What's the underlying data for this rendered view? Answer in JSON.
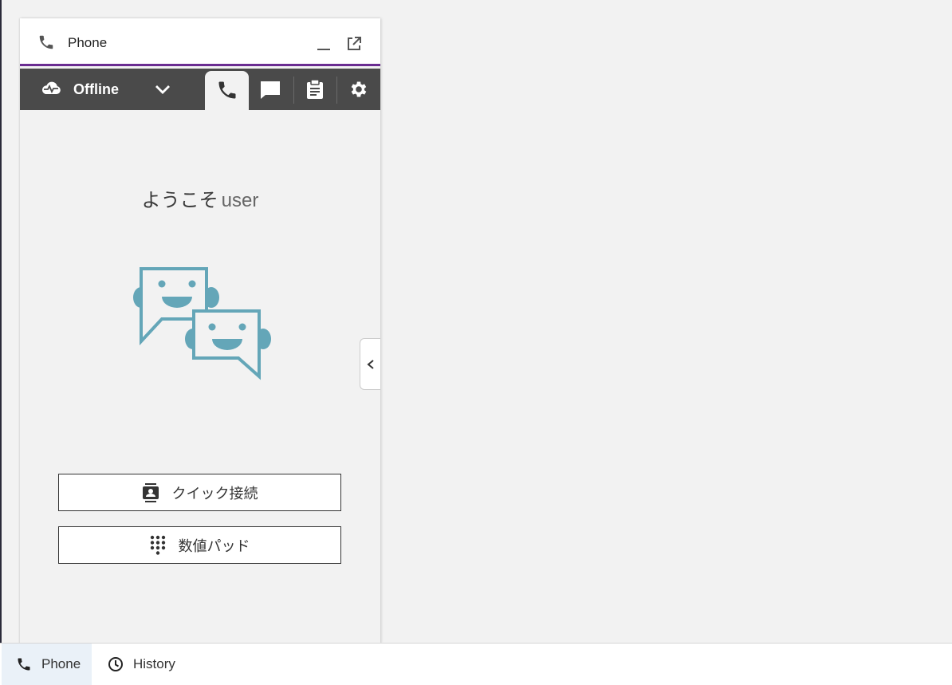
{
  "panel": {
    "title": "Phone",
    "minimize_icon": "minimize-icon",
    "popout_icon": "popout-icon"
  },
  "toolbar": {
    "status": "Offline",
    "status_icon": "cloud-icon",
    "tabs": [
      {
        "icon": "phone-icon",
        "active": true
      },
      {
        "icon": "chat-icon",
        "active": false
      },
      {
        "icon": "clipboard-icon",
        "active": false
      },
      {
        "icon": "gear-icon",
        "active": false
      }
    ]
  },
  "main": {
    "welcome_prefix": "ようこそ",
    "welcome_user": "user",
    "quick_connect_label": "クイック接続",
    "number_pad_label": "数値パッド"
  },
  "bottom_nav": {
    "phone_label": "Phone",
    "history_label": "History"
  },
  "colors": {
    "accent": "#6a2c91",
    "toolbar": "#4a4a4a",
    "illustration": "#64a6b8"
  }
}
